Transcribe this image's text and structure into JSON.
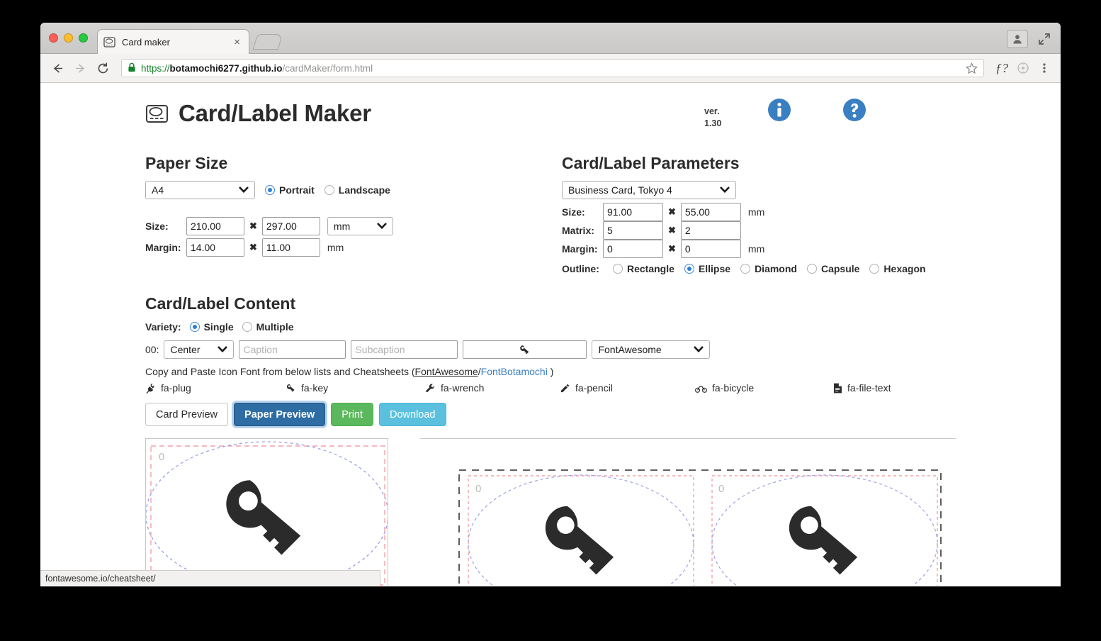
{
  "browser": {
    "tab": {
      "title": "Card maker",
      "favicon": "card-label-icon",
      "close": "×"
    },
    "url": {
      "scheme": "https://",
      "host": "botamochi6277.github.io",
      "path": "/cardMaker/form.html"
    },
    "status_text": "fontawesome.io/cheatsheet/",
    "icons": [
      "back-icon",
      "forward-icon",
      "reload-icon",
      "lock-icon",
      "star-icon",
      "font-extension-icon",
      "puzzle-extension-icon",
      "kebab-menu-icon",
      "profile-icon",
      "fullscreen-icon",
      "new-tab-icon"
    ]
  },
  "header": {
    "title": "Card/Label Maker",
    "version_label": "ver.",
    "version_number": "1.30",
    "info_icon": "info-circle-icon",
    "help_icon": "question-circle-icon",
    "accent_blue": "#3a7fc1"
  },
  "paper_size": {
    "heading": "Paper Size",
    "preset": "A4",
    "orientation_options": [
      {
        "label": "Portrait",
        "selected": true
      },
      {
        "label": "Landscape",
        "selected": false
      }
    ],
    "size_label": "Size:",
    "size_width": "210.00",
    "size_height": "297.00",
    "size_unit": "mm",
    "margin_label": "Margin:",
    "margin_width": "14.00",
    "margin_height": "11.00",
    "margin_unit": "mm",
    "multiply": "✖"
  },
  "card_params": {
    "heading": "Card/Label Parameters",
    "preset": "Business Card, Tokyo 4",
    "size_label": "Size:",
    "size_width": "91.00",
    "size_height": "55.00",
    "size_unit": "mm",
    "matrix_label": "Matrix:",
    "matrix_cols": "5",
    "matrix_rows": "2",
    "margin_label": "Margin:",
    "margin_width": "0",
    "margin_height": "0",
    "margin_unit": "mm",
    "outline_label": "Outline:",
    "outline_options": [
      {
        "label": "Rectangle",
        "selected": false
      },
      {
        "label": "Ellipse",
        "selected": true
      },
      {
        "label": "Diamond",
        "selected": false
      },
      {
        "label": "Capsule",
        "selected": false
      },
      {
        "label": "Hexagon",
        "selected": false
      }
    ],
    "multiply": "✖"
  },
  "content": {
    "heading": "Card/Label Content",
    "variety_label": "Variety:",
    "variety_options": [
      {
        "label": "Single",
        "selected": true
      },
      {
        "label": "Multiple",
        "selected": false
      }
    ],
    "row_index": "00:",
    "align": "Center",
    "caption_placeholder": "Caption",
    "caption_value": "",
    "subcaption_placeholder": "Subcaption",
    "subcaption_value": "",
    "icon_glyph": "key-icon",
    "font_family": "FontAwesome",
    "hint_prefix": "Copy and Paste Icon Font from below lists and Cheatsheets (",
    "hint_link1": "FontAwesome",
    "hint_separator": "/",
    "hint_link2": "FontBotamochi",
    "hint_suffix": " )",
    "icon_list": [
      {
        "name": "fa-plug",
        "glyph": "plug-icon"
      },
      {
        "name": "fa-key",
        "glyph": "key-icon"
      },
      {
        "name": "fa-wrench",
        "glyph": "wrench-icon"
      },
      {
        "name": "fa-pencil",
        "glyph": "pencil-icon"
      },
      {
        "name": "fa-bicycle",
        "glyph": "bicycle-icon"
      },
      {
        "name": "fa-file-text",
        "glyph": "file-text-icon"
      }
    ]
  },
  "buttons": [
    {
      "label": "Card Preview",
      "style": "default"
    },
    {
      "label": "Paper Preview",
      "style": "primary"
    },
    {
      "label": "Print",
      "style": "success"
    },
    {
      "label": "Download",
      "style": "info"
    }
  ],
  "preview": {
    "card_number": "0",
    "paper_card_numbers": [
      "0",
      "0"
    ],
    "outline_shape": "ellipse",
    "card_icon": "key-icon",
    "guide_rect_color": "#f4a0a8",
    "guide_ellipse_color": "#9aa0e8",
    "paper_margin_color": "#4a4a4a"
  }
}
